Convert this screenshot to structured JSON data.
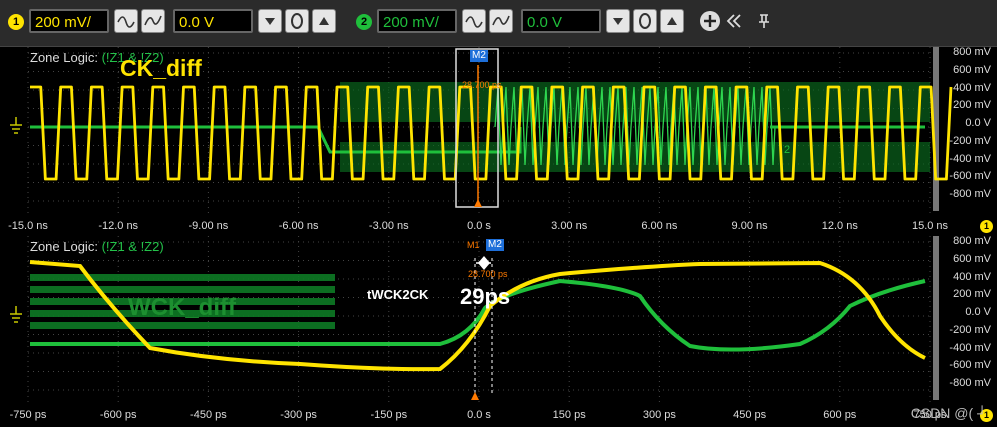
{
  "toolbar": {
    "ch1": {
      "number": "1",
      "scale": "200 mV/",
      "offset": "0.0 V",
      "color": "#ffe400"
    },
    "ch2": {
      "number": "2",
      "scale": "200 mV/",
      "offset": "0.0 V",
      "color": "#1fbf3b"
    },
    "icons": [
      "ac-coupling-icon",
      "dc-coupling-icon",
      "decrease-icon",
      "zero-icon",
      "increase-icon",
      "add-channel-icon",
      "collapse-icon",
      "pin-icon"
    ]
  },
  "top_panel": {
    "zone_label": "Zone Logic:",
    "zone_expr": "(!Z1 & !Z2)",
    "signal": "CK_diff",
    "marker_tag": "M2",
    "marker_value": "28.700 ps",
    "marker_flag": "2",
    "y_ticks": [
      "800 mV",
      "600 mV",
      "400 mV",
      "200 mV",
      "0.0 V",
      "-200 mV",
      "-400 mV",
      "-600 mV",
      "-800 mV"
    ],
    "x_ticks": [
      "-15.0 ns",
      "-12.0 ns",
      "-9.00 ns",
      "-6.00 ns",
      "-3.00 ns",
      "0.0 s",
      "3.00 ns",
      "6.00 ns",
      "9.00 ns",
      "12.0 ns",
      "15.0 ns"
    ],
    "axis_badge": "1"
  },
  "bottom_panel": {
    "zone_label": "Zone Logic:",
    "zone_expr": "(!Z1 & !Z2)",
    "signal": "WCK_diff",
    "marker_tags": [
      "M1",
      "M2"
    ],
    "marker_value": "28.700 ps",
    "annotation_label": "tWCK2CK",
    "annotation_value": "29ps",
    "y_ticks": [
      "800 mV",
      "600 mV",
      "400 mV",
      "200 mV",
      "0.0 V",
      "-200 mV",
      "-400 mV",
      "-600 mV",
      "-800 mV"
    ],
    "x_ticks": [
      "-750 ps",
      "-600 ps",
      "-450 ps",
      "-300 ps",
      "-150 ps",
      "0.0 s",
      "150 ps",
      "300 ps",
      "450 ps",
      "600 ps",
      "750 ps"
    ],
    "axis_badge": "1"
  },
  "watermark": "CSDN @( ┘"
}
